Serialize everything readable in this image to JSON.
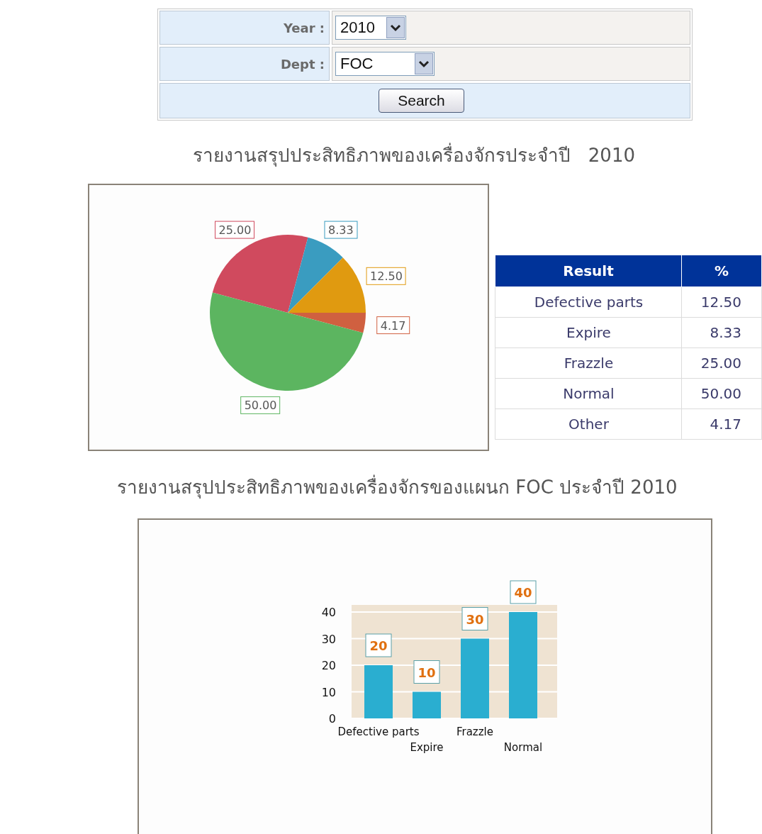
{
  "form": {
    "fields": [
      {
        "label": "Year :",
        "value": "2010"
      },
      {
        "label": "Dept :",
        "value": "FOC"
      }
    ],
    "button": "Search"
  },
  "summary_title": "รายงานสรุปประสิทธิภาพของเครื่องจักรประจำปี   2010",
  "pie_chart": {
    "chart_data": {
      "type": "pie",
      "series": [
        {
          "colors": [
            "#d04a5e",
            "#3a9cc0",
            "#e09a10",
            "#d06040",
            "#5cb560"
          ],
          "values": [
            25,
            8.33,
            12.5,
            4.17,
            50
          ]
        }
      ],
      "value_labels": [
        "25.00",
        "8.33",
        "12.50",
        "4.17",
        "50.00"
      ]
    }
  },
  "result_table": {
    "columns": [
      "Result",
      "%"
    ],
    "rows": [
      [
        "Defective parts",
        "12.50"
      ],
      [
        "Expire",
        "8.33"
      ],
      [
        "Frazzle",
        "25.00"
      ],
      [
        "Normal",
        "50.00"
      ],
      [
        "Other",
        "4.17"
      ]
    ]
  },
  "dept_title": "รายงานสรุปประสิทธิภาพของเครื่องจักรของแผนก FOC ประจำปี 2010",
  "bar_chart": {
    "chart_data": {
      "type": "bar",
      "categories": [
        "Defective parts",
        "Expire",
        "Frazzle",
        "Normal"
      ],
      "series": [
        {
          "color": "#2aaed0",
          "values": [
            20,
            10,
            30,
            40
          ]
        }
      ],
      "yticks": [
        0,
        10,
        20,
        30,
        40
      ],
      "ylim": [
        0,
        40
      ],
      "grid": true,
      "data_labels": true
    }
  }
}
